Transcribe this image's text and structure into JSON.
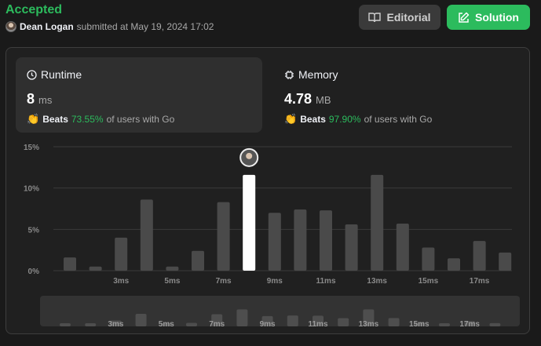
{
  "header": {
    "status": "Accepted",
    "user": "Dean Logan",
    "submitted_text": "submitted at May 19, 2024 17:02"
  },
  "buttons": {
    "editorial": "Editorial",
    "solution": "Solution"
  },
  "runtime": {
    "title": "Runtime",
    "value": "8",
    "unit": "ms",
    "beats_label": "Beats",
    "beats_pct": "73.55%",
    "beats_suffix": "of users with Go"
  },
  "memory": {
    "title": "Memory",
    "value": "4.78",
    "unit": "MB",
    "beats_label": "Beats",
    "beats_pct": "97.90%",
    "beats_suffix": "of users with Go"
  },
  "colors": {
    "accent_green": "#2cbb5d",
    "bar": "#4a4a4a",
    "highlight_bar": "#ffffff"
  },
  "chart_data": {
    "type": "bar",
    "categories": [
      "1ms",
      "2ms",
      "3ms",
      "4ms",
      "5ms",
      "6ms",
      "7ms",
      "8ms",
      "9ms",
      "10ms",
      "11ms",
      "12ms",
      "13ms",
      "14ms",
      "15ms",
      "16ms",
      "17ms",
      "18ms"
    ],
    "tick_labels": [
      "3ms",
      "5ms",
      "7ms",
      "9ms",
      "11ms",
      "13ms",
      "15ms",
      "17ms"
    ],
    "values": [
      1.6,
      0.5,
      4.0,
      8.6,
      0.5,
      2.4,
      8.3,
      11.6,
      7.0,
      7.4,
      7.3,
      5.6,
      11.6,
      5.7,
      2.8,
      1.5,
      3.6,
      2.2
    ],
    "highlight_index": 7,
    "y_ticks": [
      "0%",
      "5%",
      "10%",
      "15%"
    ],
    "ylim": [
      0,
      15
    ],
    "grid": true
  }
}
